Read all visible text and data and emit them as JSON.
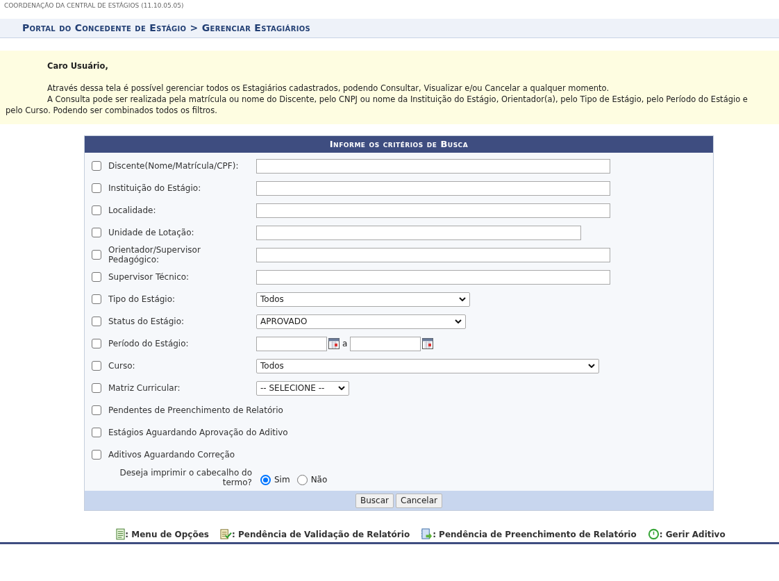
{
  "top_strip": {
    "text": "COORDENAÇÃO DA CENTRAL DE ESTÁGIOS (11.10.05.05)"
  },
  "breadcrumb": "Portal do Concedente de Estágio > Gerenciar Estagiários",
  "notice": {
    "greeting": "Caro Usuário,",
    "paragraphs": [
      "Através dessa tela é possível gerenciar todos os Estagiários cadastrados, podendo Consultar, Visualizar e/ou Cancelar a qualquer momento.",
      "A Consulta pode ser realizada pela matrícula ou nome do Discente, pelo CNPJ ou nome da Instituição do Estágio, Orientador(a), pelo Tipo de Estágio, pelo Período do Estágio e pelo Curso. Podendo ser combinados todos os filtros."
    ]
  },
  "form": {
    "title": "Informe os critérios de Busca",
    "rows": [
      {
        "kind": "text",
        "label": "Discente(Nome/Matrícula/CPF):",
        "checked": false
      },
      {
        "kind": "text",
        "label": "Instituição do Estágio:",
        "checked": false
      },
      {
        "kind": "text",
        "label": "Localidade:",
        "checked": false
      },
      {
        "kind": "text",
        "label": "Unidade de Lotação:",
        "checked": false
      },
      {
        "kind": "text",
        "label": "Orientador/Supervisor Pedagógico:",
        "checked": false
      },
      {
        "kind": "text",
        "label": "Supervisor Técnico:",
        "checked": false
      },
      {
        "kind": "select",
        "label": "Tipo do Estágio:",
        "checked": false,
        "value": "Todos"
      },
      {
        "kind": "select",
        "label": "Status do Estágio:",
        "checked": false,
        "value": "APROVADO"
      },
      {
        "kind": "date_range",
        "label": "Período do Estágio:",
        "checked": false,
        "separator": "a"
      },
      {
        "kind": "select",
        "label": "Curso:",
        "checked": false,
        "value": "Todos"
      },
      {
        "kind": "select",
        "label": "Matriz Curricular:",
        "checked": false,
        "value": "-- SELECIONE --"
      },
      {
        "kind": "flag",
        "label": "Pendentes de Preenchimento de Relatório",
        "checked": false
      },
      {
        "kind": "flag",
        "label": "Estágios Aguardando Aprovação do Aditivo",
        "checked": false
      },
      {
        "kind": "flag",
        "label": "Aditivos Aguardando Correção",
        "checked": false
      }
    ],
    "print_header": {
      "label": "Deseja imprimir o cabecalho do termo?",
      "options": [
        {
          "label": "Sim",
          "selected": true
        },
        {
          "label": "Não",
          "selected": false
        }
      ]
    },
    "buttons": [
      "Buscar",
      "Cancelar"
    ]
  },
  "legend": [
    {
      "kind": "menu",
      "label": ": Menu de Opções"
    },
    {
      "kind": "validation",
      "label": ": Pendência de Validação de Relatório"
    },
    {
      "kind": "fill",
      "label": ": Pendência de Preenchimento de Relatório"
    },
    {
      "kind": "addendum",
      "label": ": Gerir Aditivo"
    }
  ]
}
